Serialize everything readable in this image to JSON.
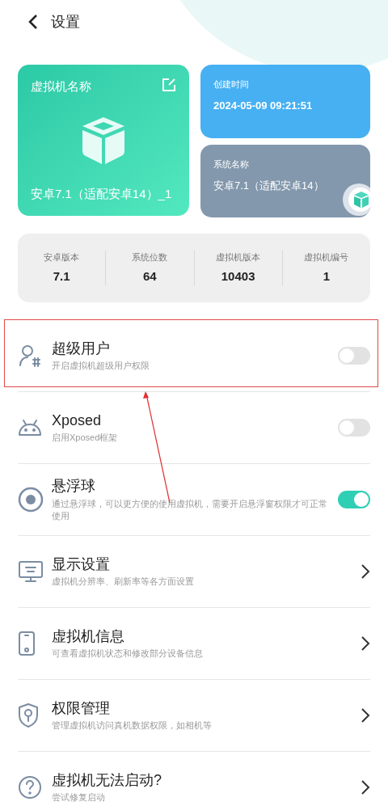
{
  "header": {
    "title": "设置"
  },
  "name_card": {
    "label": "虚拟机名称",
    "value": "安卓7.1（适配安卓14）_1"
  },
  "created_card": {
    "label": "创建时间",
    "value": "2024-05-09 09:21:51"
  },
  "system_card": {
    "label": "系统名称",
    "value": "安卓7.1（适配安卓14）"
  },
  "stats": [
    {
      "label": "安卓版本",
      "value": "7.1"
    },
    {
      "label": "系统位数",
      "value": "64"
    },
    {
      "label": "虚拟机版本",
      "value": "10403"
    },
    {
      "label": "虚拟机编号",
      "value": "1"
    }
  ],
  "settings": [
    {
      "kind": "toggle",
      "title": "超级用户",
      "subtitle": "开启虚拟机超级用户权限",
      "on": false,
      "highlighted": true
    },
    {
      "kind": "toggle",
      "title": "Xposed",
      "subtitle": "启用Xposed框架",
      "on": false,
      "highlighted": false
    },
    {
      "kind": "toggle",
      "title": "悬浮球",
      "subtitle": "通过悬浮球，可以更方便的使用虚拟机，需要开启悬浮窗权限才可正常使用",
      "on": true,
      "highlighted": false
    },
    {
      "kind": "link",
      "title": "显示设置",
      "subtitle": "虚拟机分辨率、刷新率等各方面设置",
      "highlighted": false
    },
    {
      "kind": "link",
      "title": "虚拟机信息",
      "subtitle": "可查看虚拟机状态和修改部分设备信息",
      "highlighted": false
    },
    {
      "kind": "link",
      "title": "权限管理",
      "subtitle": "管理虚拟机访问真机数据权限，如相机等",
      "highlighted": false
    },
    {
      "kind": "link",
      "title": "虚拟机无法启动?",
      "subtitle": "尝试修复启动",
      "highlighted": false
    }
  ]
}
